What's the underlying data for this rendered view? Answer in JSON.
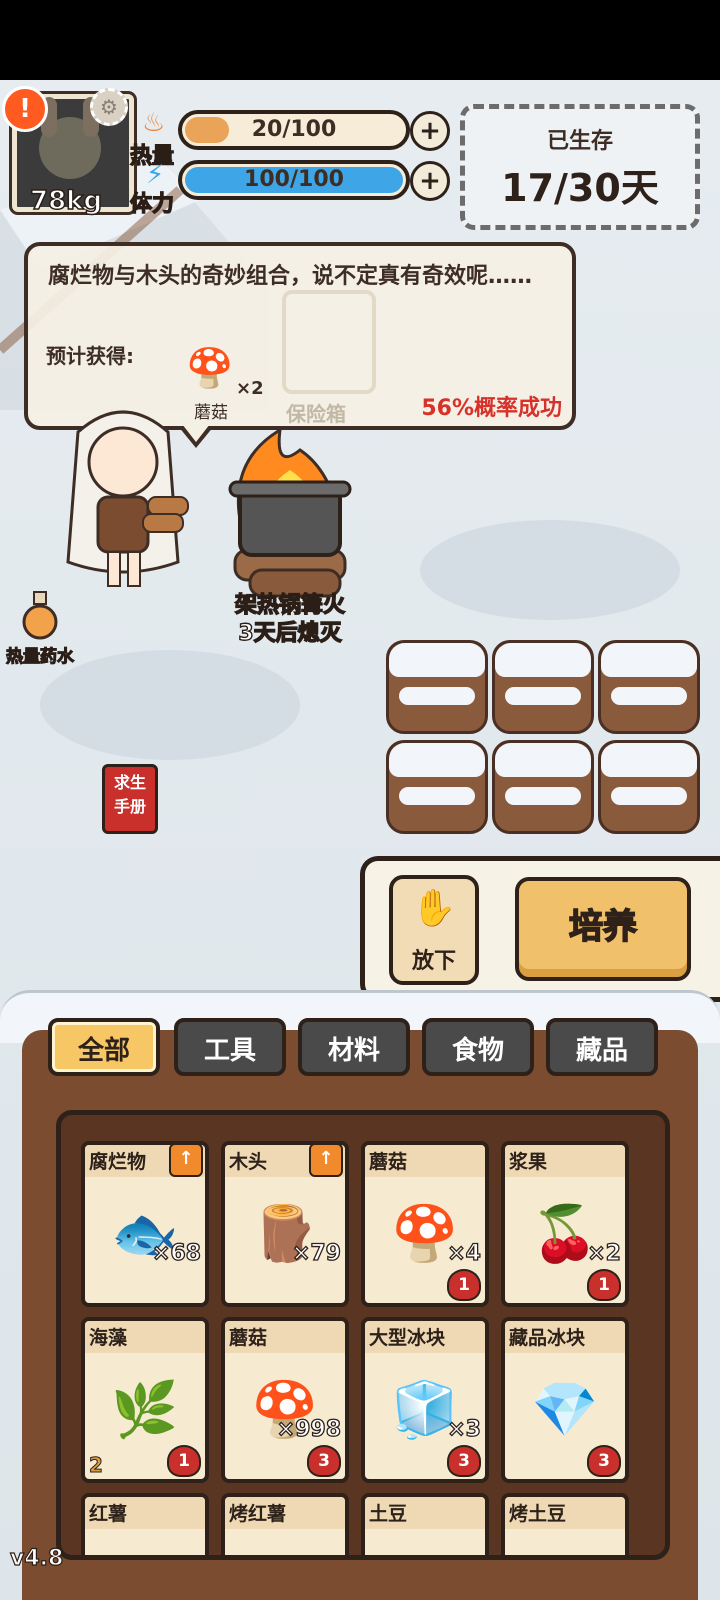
{
  "hud": {
    "weight": "78kg",
    "heat_label": "热量",
    "heat_value": "20/100",
    "heat_fill_fraction": 0.2,
    "stamina_label": "体力",
    "stamina_value": "100/100",
    "stamina_fill_fraction": 1.0,
    "survived_label": "已生存",
    "survived_value": "17/30天"
  },
  "dialog": {
    "message": "腐烂物与木头的奇妙组合，说不定真有奇效呢……",
    "expected_label": "预计获得:",
    "reward_name": "蘑菇",
    "reward_count": "×2",
    "locked_reward_name": "保险箱",
    "success_rate": "56%概率成功"
  },
  "scene": {
    "pot_line1": "架热锅篝火",
    "pot_line2": "3天后熄灭",
    "potion_label": "热量药水",
    "manual_label_1": "求生",
    "manual_label_2": "手册"
  },
  "actions": {
    "drop_label": "放下",
    "cultivate_label": "培养"
  },
  "tabs": [
    "全部",
    "工具",
    "材料",
    "食物",
    "藏品"
  ],
  "active_tab": "全部",
  "inventory": [
    {
      "name": "腐烂物",
      "qty": "×68",
      "level": "",
      "badge": "",
      "upgrade": true,
      "icon": "rotten-icon"
    },
    {
      "name": "木头",
      "qty": "×79",
      "level": "",
      "badge": "",
      "upgrade": true,
      "icon": "wood-icon"
    },
    {
      "name": "蘑菇",
      "qty": "×4",
      "level": "",
      "badge": "1",
      "upgrade": false,
      "icon": "mushroom-icon"
    },
    {
      "name": "浆果",
      "qty": "×2",
      "level": "",
      "badge": "1",
      "upgrade": false,
      "icon": "berry-icon"
    },
    {
      "name": "海藻",
      "qty": "",
      "level": "2",
      "badge": "1",
      "upgrade": false,
      "icon": "seaweed-icon"
    },
    {
      "name": "蘑菇",
      "qty": "×998",
      "level": "",
      "badge": "3",
      "upgrade": false,
      "icon": "mushroom-icon"
    },
    {
      "name": "大型冰块",
      "qty": "×3",
      "level": "",
      "badge": "3",
      "upgrade": false,
      "icon": "ice-icon"
    },
    {
      "name": "藏品冰块",
      "qty": "",
      "level": "",
      "badge": "3",
      "upgrade": false,
      "icon": "ice-crystal-icon"
    },
    {
      "name": "红薯",
      "qty": "",
      "level": "",
      "badge": "",
      "upgrade": false,
      "icon": "sweet-potato-icon"
    },
    {
      "name": "烤红薯",
      "qty": "",
      "level": "",
      "badge": "",
      "upgrade": false,
      "icon": "roasted-sweet-potato-icon"
    },
    {
      "name": "土豆",
      "qty": "",
      "level": "",
      "badge": "",
      "upgrade": false,
      "icon": "potato-icon"
    },
    {
      "name": "烤土豆",
      "qty": "",
      "level": "",
      "badge": "",
      "upgrade": false,
      "icon": "roasted-potato-icon"
    }
  ],
  "version": "v4.8",
  "colors": {
    "heat_bar": "#e9a45a",
    "stamina_bar": "#3ea6e6",
    "success_rate": "#d8312a",
    "active_tab": "#f7c765"
  }
}
